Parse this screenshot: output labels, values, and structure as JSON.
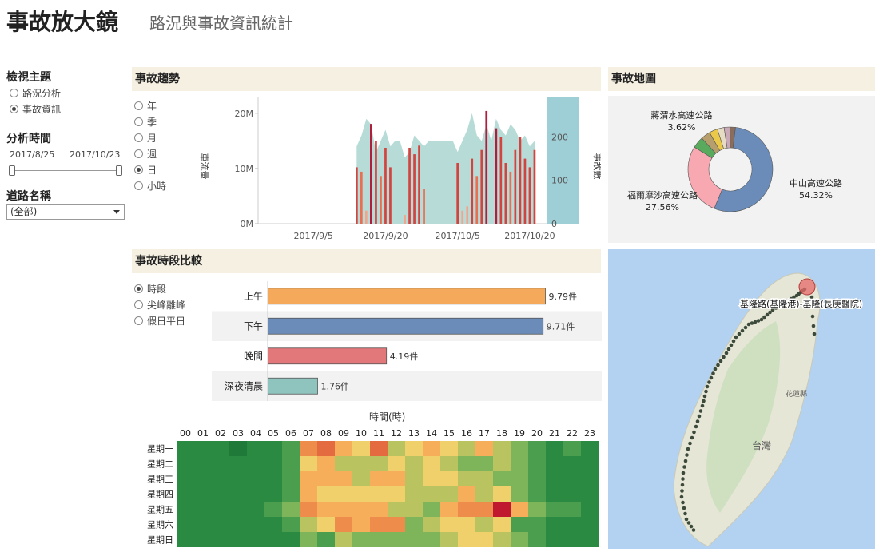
{
  "header": {
    "title": "事故放大鏡",
    "subtitle": "路況與事故資訊統計"
  },
  "sidebar": {
    "topic_title": "檢視主題",
    "topic_options": [
      "路況分析",
      "事故資訊"
    ],
    "topic_selected": 1,
    "time_title": "分析時間",
    "time_start": "2017/8/25",
    "time_end": "2017/10/23",
    "road_title": "道路名稱",
    "road_value": "(全部)"
  },
  "trend": {
    "title": "事故趨勢",
    "granularity_options": [
      "年",
      "季",
      "月",
      "週",
      "日",
      "小時"
    ],
    "granularity_selected": 4,
    "left_axis_label": "車流量",
    "right_axis_label": "事故數",
    "left_ticks": [
      "20M",
      "10M",
      "0M"
    ],
    "right_ticks": [
      "200",
      "100",
      "0"
    ],
    "date_ticks": [
      "2017/9/5",
      "2017/9/20",
      "2017/10/5",
      "2017/10/20"
    ]
  },
  "period": {
    "title": "事故時段比較",
    "options": [
      "時段",
      "尖峰離峰",
      "假日平日"
    ],
    "selected": 0,
    "unit": "件"
  },
  "heatmap": {
    "title": "時間(時)",
    "hours": [
      "00",
      "01",
      "02",
      "03",
      "04",
      "05",
      "06",
      "07",
      "08",
      "09",
      "10",
      "11",
      "12",
      "13",
      "14",
      "15",
      "16",
      "17",
      "18",
      "19",
      "20",
      "21",
      "22",
      "23"
    ],
    "days": [
      "星期一",
      "星期二",
      "星期三",
      "星期四",
      "星期五",
      "星期六",
      "星期日"
    ]
  },
  "map": {
    "title": "事故地圖",
    "route_label": "基隆路(基隆港)-基隆(長庚醫院)",
    "place_labels": [
      "花蓮縣",
      "台灣"
    ]
  },
  "colors": {
    "panel_header": "#f5f0e1",
    "accent_teal": "#9fcfcc",
    "accent_red": "#c8283c",
    "bar_orange": "#f4a95b",
    "bar_blue": "#6b8cb8",
    "bar_red": "#e2787a",
    "bar_teal": "#8fc3be"
  },
  "chart_data": [
    {
      "type": "bar",
      "chart": "period-bars",
      "categories": [
        "上午",
        "下午",
        "晚間",
        "深夜清晨"
      ],
      "values": [
        9.79,
        9.71,
        4.19,
        1.76
      ],
      "value_labels": [
        "9.79件",
        "9.71件",
        "4.19件",
        "1.76件"
      ],
      "xlim": [
        0,
        10
      ]
    },
    {
      "type": "pie",
      "chart": "road-donut",
      "slices": [
        {
          "name": "中山高速公路",
          "value": 54.32,
          "label": "54.32%",
          "color": "#6b8cb8"
        },
        {
          "name": "福爾摩沙高速公路",
          "value": 27.56,
          "label": "27.56%",
          "color": "#f7a8b1"
        },
        {
          "name": "",
          "value": 4.4,
          "label": "",
          "color": "#5aaa5e"
        },
        {
          "name": "蔣渭水高速公路",
          "value": 3.62,
          "label": "3.62%",
          "color": "#b79f6d"
        },
        {
          "name": "",
          "value": 3.2,
          "label": "",
          "color": "#e9c84a"
        },
        {
          "name": "",
          "value": 2.6,
          "label": "",
          "color": "#e6dcc3"
        },
        {
          "name": "",
          "value": 2.3,
          "label": "",
          "color": "#c9a9b8"
        },
        {
          "name": "",
          "value": 1.99,
          "label": "",
          "color": "#8a6d5a"
        }
      ]
    },
    {
      "type": "bar",
      "chart": "accident-trend",
      "x": [
        "8/25",
        "8/26",
        "8/27",
        "8/28",
        "8/29",
        "8/30",
        "8/31",
        "9/1",
        "9/2",
        "9/3",
        "9/4",
        "9/5",
        "9/6",
        "9/7",
        "9/8",
        "9/9",
        "9/10",
        "9/11",
        "9/12",
        "9/13",
        "9/14",
        "9/15",
        "9/16",
        "9/17",
        "9/18",
        "9/19",
        "9/20",
        "9/21",
        "9/22",
        "9/23",
        "9/24",
        "9/25",
        "9/26",
        "9/27",
        "9/28",
        "9/29",
        "9/30",
        "10/1",
        "10/2",
        "10/3",
        "10/4",
        "10/5",
        "10/6",
        "10/7",
        "10/8",
        "10/9",
        "10/10",
        "10/11",
        "10/12",
        "10/13",
        "10/14",
        "10/15",
        "10/16",
        "10/17",
        "10/18",
        "10/19",
        "10/20",
        "10/21",
        "10/22",
        "10/23"
      ],
      "accidents": [
        0,
        0,
        0,
        0,
        0,
        0,
        0,
        0,
        0,
        0,
        0,
        0,
        0,
        0,
        0,
        0,
        0,
        0,
        0,
        0,
        130,
        120,
        30,
        230,
        190,
        110,
        175,
        130,
        0,
        0,
        20,
        175,
        160,
        180,
        80,
        0,
        0,
        0,
        0,
        0,
        0,
        140,
        30,
        40,
        150,
        110,
        170,
        260,
        0,
        220,
        200,
        140,
        120,
        170,
        200,
        150,
        130,
        170,
        0,
        0
      ],
      "traffic": [
        0,
        0,
        0,
        0,
        0,
        0,
        0,
        0,
        0,
        0,
        0,
        0,
        0,
        0,
        0,
        0,
        0,
        0,
        0,
        0,
        14,
        16,
        19,
        18,
        13,
        15,
        17,
        14,
        0,
        0,
        12,
        13,
        16,
        15,
        14,
        0,
        0,
        0,
        0,
        0,
        0,
        13,
        15,
        17,
        20,
        16,
        15,
        18,
        0,
        19,
        17,
        16,
        18,
        17,
        15,
        16,
        14,
        15,
        0,
        0
      ],
      "ylim_traffic": [
        0,
        22
      ],
      "ylim_accidents": [
        0,
        280
      ]
    },
    {
      "type": "heatmap",
      "chart": "hour-weekday-heatmap",
      "rows": [
        "星期一",
        "星期二",
        "星期三",
        "星期四",
        "星期五",
        "星期六",
        "星期日"
      ],
      "cols": [
        "00",
        "01",
        "02",
        "03",
        "04",
        "05",
        "06",
        "07",
        "08",
        "09",
        "10",
        "11",
        "12",
        "13",
        "14",
        "15",
        "16",
        "17",
        "18",
        "19",
        "20",
        "21",
        "22",
        "23"
      ],
      "values": [
        [
          1,
          1,
          1,
          0,
          1,
          1,
          2,
          7,
          8,
          6,
          5,
          8,
          4,
          5,
          6,
          5,
          4,
          6,
          4,
          3,
          2,
          1,
          2,
          1
        ],
        [
          1,
          1,
          1,
          1,
          1,
          1,
          2,
          5,
          6,
          4,
          4,
          4,
          5,
          4,
          5,
          4,
          3,
          3,
          4,
          3,
          2,
          1,
          1,
          1
        ],
        [
          1,
          1,
          1,
          1,
          1,
          1,
          2,
          6,
          6,
          6,
          4,
          6,
          6,
          4,
          5,
          5,
          4,
          4,
          3,
          3,
          2,
          1,
          1,
          1
        ],
        [
          1,
          1,
          1,
          1,
          1,
          1,
          2,
          6,
          5,
          5,
          5,
          5,
          5,
          4,
          4,
          4,
          6,
          4,
          5,
          3,
          2,
          1,
          1,
          1
        ],
        [
          1,
          1,
          1,
          1,
          1,
          2,
          3,
          7,
          6,
          6,
          6,
          6,
          4,
          4,
          3,
          6,
          7,
          7,
          9,
          6,
          3,
          2,
          2,
          1
        ],
        [
          1,
          1,
          1,
          1,
          1,
          1,
          2,
          4,
          5,
          7,
          6,
          7,
          7,
          3,
          4,
          5,
          5,
          4,
          5,
          2,
          2,
          1,
          1,
          1
        ],
        [
          1,
          1,
          1,
          1,
          1,
          1,
          1,
          3,
          2,
          4,
          3,
          3,
          3,
          3,
          3,
          4,
          5,
          5,
          4,
          3,
          2,
          1,
          1,
          1
        ]
      ],
      "range": [
        0,
        9
      ]
    }
  ]
}
